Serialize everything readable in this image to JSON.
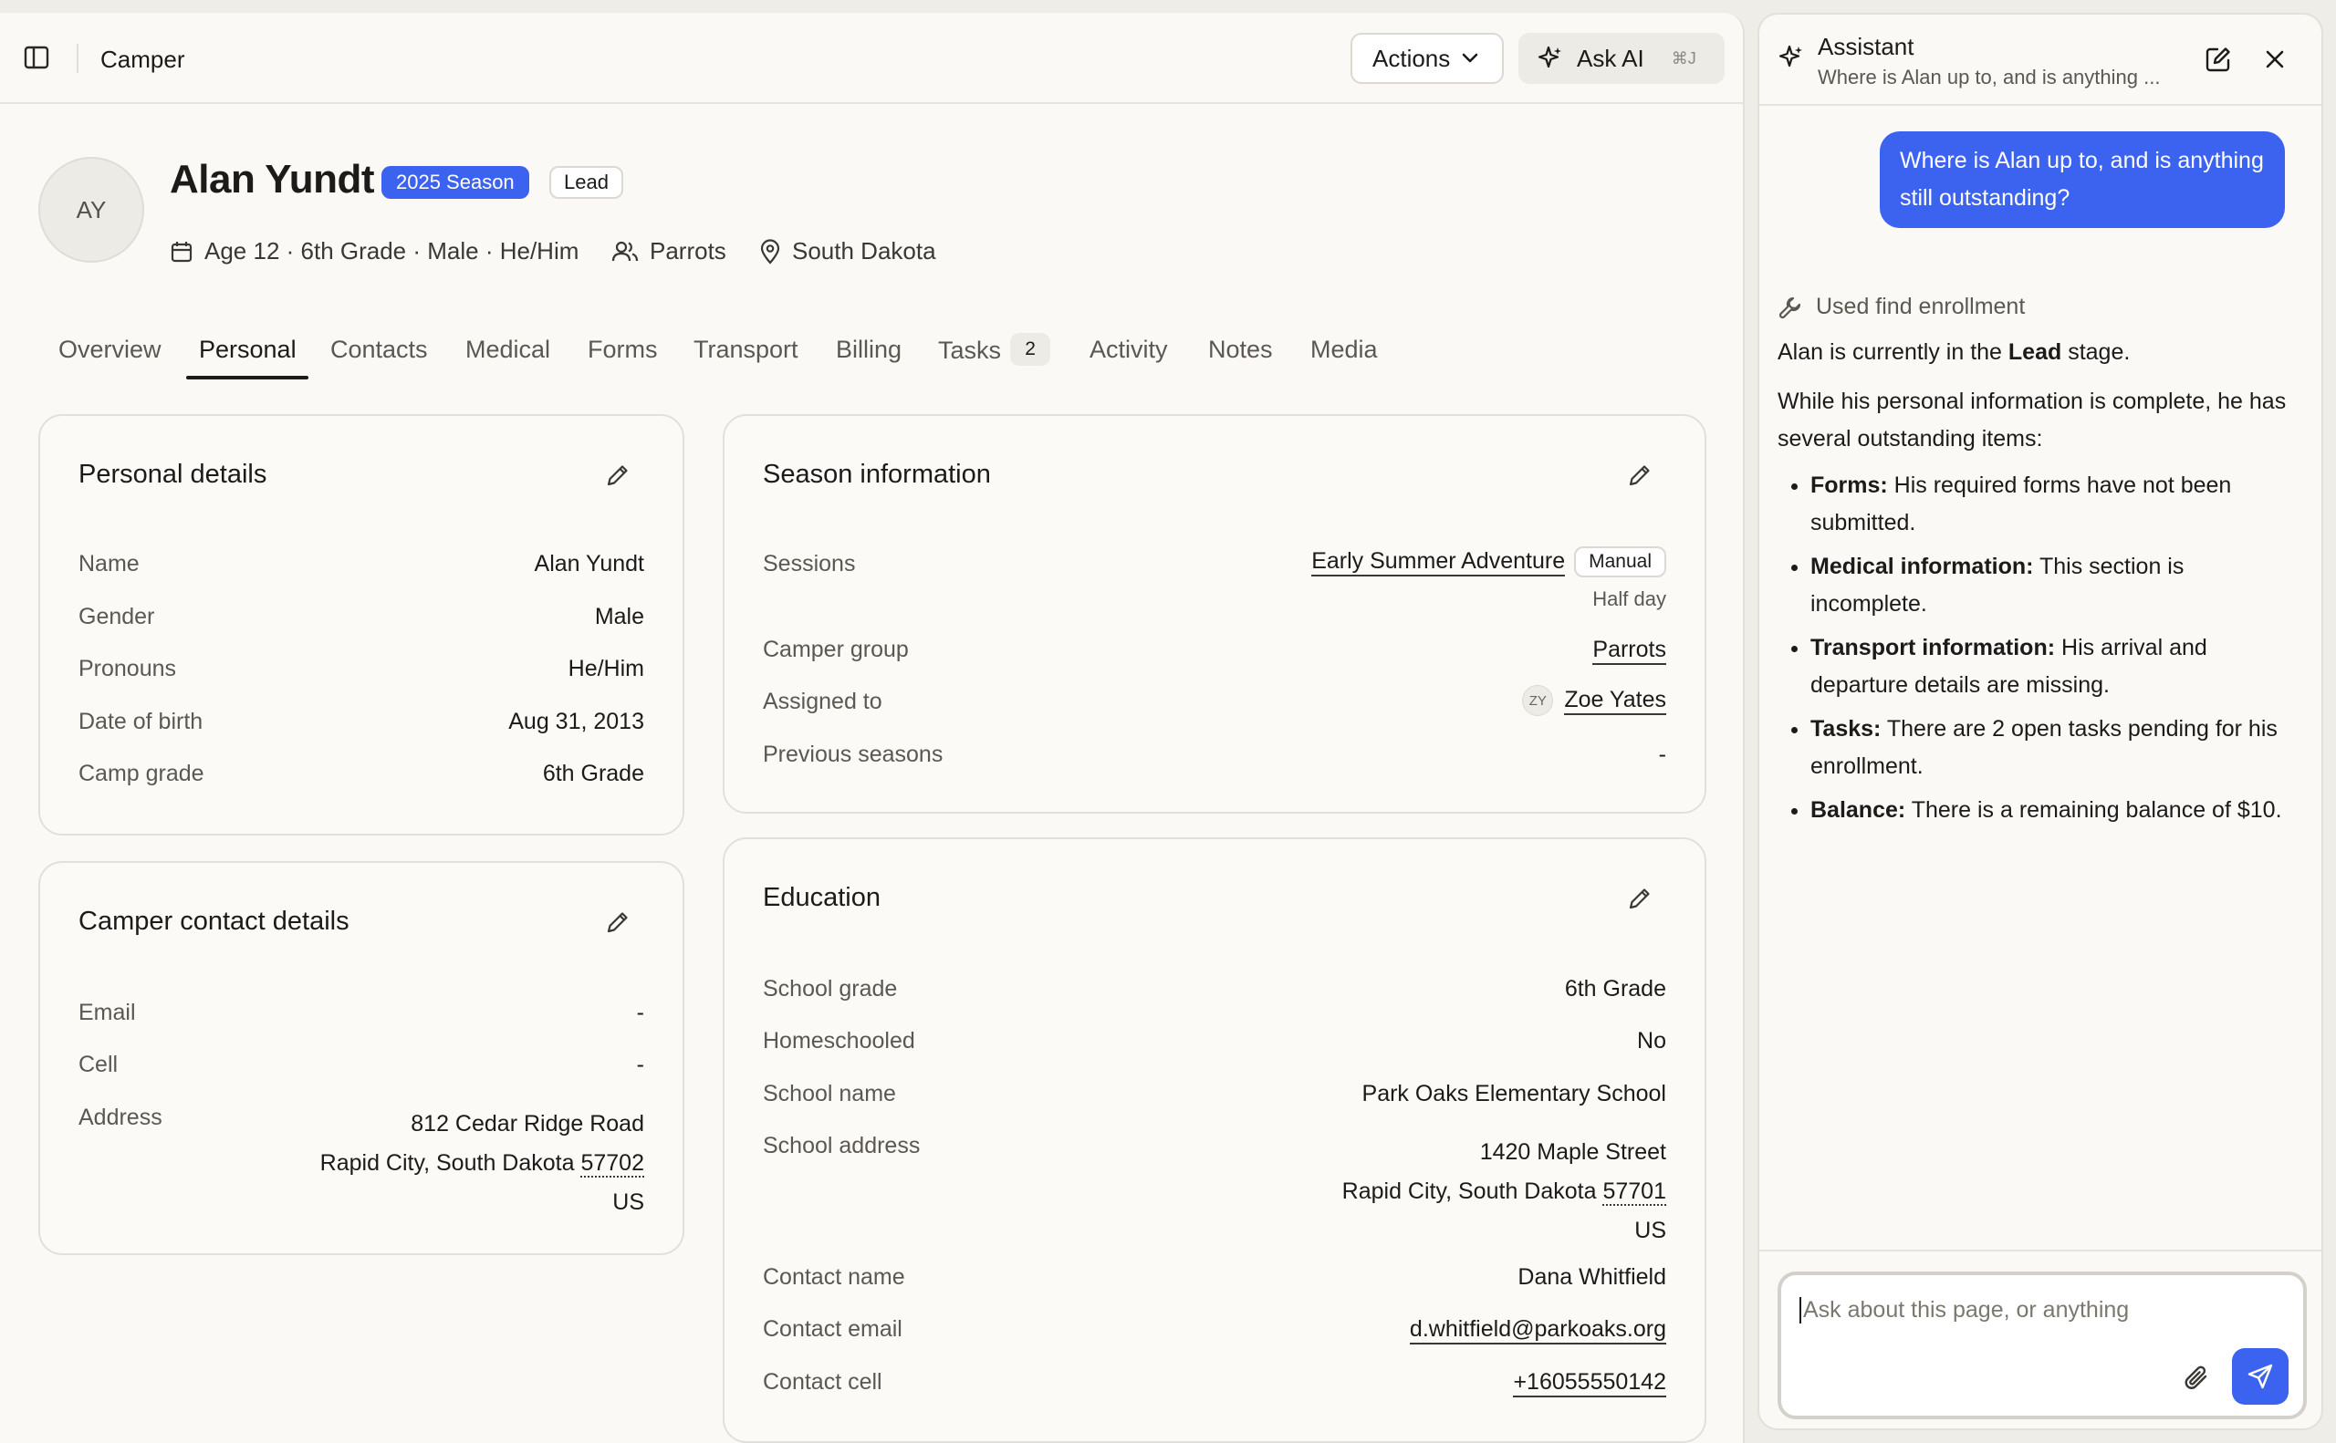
{
  "topbar": {
    "breadcrumb": "Camper",
    "actions_label": "Actions",
    "ask_ai_label": "Ask AI",
    "ask_ai_shortcut": "⌘J"
  },
  "camper": {
    "initials": "AY",
    "name": "Alan Yundt",
    "season_badge": "2025 Season",
    "stage_badge": "Lead",
    "meta_age": "Age 12 · 6th Grade · Male · He/Him",
    "meta_group": "Parrots",
    "meta_location": "South Dakota"
  },
  "tabs": [
    {
      "label": "Overview"
    },
    {
      "label": "Personal"
    },
    {
      "label": "Contacts"
    },
    {
      "label": "Medical"
    },
    {
      "label": "Forms"
    },
    {
      "label": "Transport"
    },
    {
      "label": "Billing"
    },
    {
      "label": "Tasks",
      "count": "2"
    },
    {
      "label": "Activity"
    },
    {
      "label": "Notes"
    },
    {
      "label": "Media"
    }
  ],
  "personal": {
    "title": "Personal details",
    "rows": [
      {
        "label": "Name",
        "value": "Alan Yundt"
      },
      {
        "label": "Gender",
        "value": "Male"
      },
      {
        "label": "Pronouns",
        "value": "He/Him"
      },
      {
        "label": "Date of birth",
        "value": "Aug 31, 2013"
      },
      {
        "label": "Camp grade",
        "value": "6th Grade"
      }
    ]
  },
  "contact": {
    "title": "Camper contact details",
    "email_label": "Email",
    "email_value": "-",
    "cell_label": "Cell",
    "cell_value": "-",
    "address_label": "Address",
    "address_line1": "812 Cedar Ridge Road",
    "address_city": "Rapid City, South Dakota",
    "address_zip": "57702",
    "address_country": "US"
  },
  "season": {
    "title": "Season information",
    "sessions_label": "Sessions",
    "session_name": "Early Summer Adventure",
    "session_badge": "Manual",
    "session_sub": "Half day",
    "group_label": "Camper group",
    "group_value": "Parrots",
    "assigned_label": "Assigned to",
    "assigned_initials": "ZY",
    "assigned_value": "Zoe Yates",
    "previous_label": "Previous seasons",
    "previous_value": "-"
  },
  "education": {
    "title": "Education",
    "grade_label": "School grade",
    "grade_value": "6th Grade",
    "home_label": "Homeschooled",
    "home_value": "No",
    "school_label": "School name",
    "school_value": "Park Oaks Elementary School",
    "address_label": "School address",
    "address_line1": "1420 Maple Street",
    "address_city": "Rapid City, South Dakota",
    "address_zip": "57701",
    "address_country": "US",
    "contact_name_label": "Contact name",
    "contact_name_value": "Dana Whitfield",
    "contact_email_label": "Contact email",
    "contact_email_value": "d.whitfield@parkoaks.org",
    "contact_cell_label": "Contact cell",
    "contact_cell_value": "+16055550142"
  },
  "assistant": {
    "title": "Assistant",
    "subtitle": "Where is Alan up to, and is anything ...",
    "user_message": "Where is Alan up to, and is anything still outstanding?",
    "tool_used": "Used find enrollment",
    "reply_intro_pre": "Alan is currently in the ",
    "reply_intro_bold": "Lead",
    "reply_intro_post": " stage.",
    "reply_para": "While his personal information is complete, he has several outstanding items:",
    "items": [
      {
        "label": "Forms:",
        "text": " His required forms have not been submitted."
      },
      {
        "label": "Medical information:",
        "text": " This section is incomplete."
      },
      {
        "label": "Transport information:",
        "text": " His arrival and departure details are missing."
      },
      {
        "label": "Tasks:",
        "text": " There are 2 open tasks pending for his enrollment."
      },
      {
        "label": "Balance:",
        "text": " There is a remaining balance of $10."
      }
    ],
    "composer_placeholder": "Ask about this page, or anything"
  },
  "colors": {
    "accent": "#3b63f0",
    "background": "#faf9f6"
  }
}
